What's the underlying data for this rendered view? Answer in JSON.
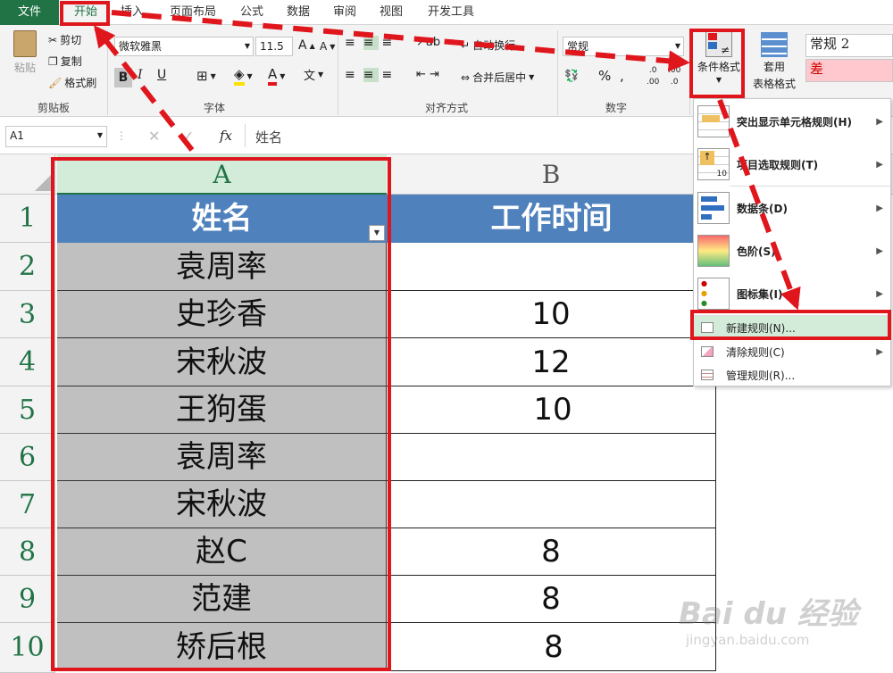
{
  "ribbon_tabs": [
    "文件",
    "开始",
    "插入",
    "页面布局",
    "公式",
    "数据",
    "审阅",
    "视图",
    "开发工具"
  ],
  "clipboard": {
    "paste": "粘贴",
    "cut": "剪切",
    "copy": "复制",
    "format_painter": "格式刷",
    "group": "剪贴板"
  },
  "font": {
    "name": "微软雅黑",
    "size": "11.5",
    "bold": "B",
    "italic": "I",
    "underline": "U",
    "grow": "A",
    "shrink": "A",
    "color_a": "A",
    "wen": "文",
    "group": "字体"
  },
  "alignment": {
    "wrap": "自动换行",
    "merge": "合并后居中",
    "group": "对齐方式"
  },
  "number": {
    "format": "常规",
    "percent": "%",
    "comma": ",",
    "group": "数字",
    "inc": ".00",
    "dec": ".0"
  },
  "styles": {
    "conditional": "条件格式",
    "table_format_1": "套用",
    "table_format_2": "表格格式",
    "style_normal2": "常规 2",
    "style_bad": "差"
  },
  "formula_bar": {
    "name_box": "A1",
    "fx": "fx",
    "value": "姓名"
  },
  "columns": [
    "A",
    "B"
  ],
  "rows": [
    "1",
    "2",
    "3",
    "4",
    "5",
    "6",
    "7",
    "8",
    "9",
    "10"
  ],
  "table": {
    "headers": [
      "姓名",
      "工作时间"
    ],
    "names": [
      "袁周率",
      "史珍香",
      "宋秋波",
      "王狗蛋",
      "袁周率",
      "宋秋波",
      "赵C",
      "范建",
      "矫后根"
    ],
    "hours": [
      "",
      "10",
      "12",
      "10",
      "",
      "",
      "8",
      "8",
      "8"
    ]
  },
  "cf_menu": {
    "items": [
      "突出显示单元格规则(H)",
      "项目选取规则(T)",
      "数据条(D)",
      "色阶(S)",
      "图标集(I)"
    ],
    "actions": [
      "新建规则(N)...",
      "清除规则(C)",
      "管理规则(R)..."
    ]
  },
  "watermark": {
    "line1": "Bai du 经验",
    "line2": "jingyan.baidu.com"
  },
  "colors": {
    "excel_green": "#217346",
    "header_blue": "#4f81bd",
    "red": "#e0161d",
    "selection_green": "#d3ecd9"
  }
}
